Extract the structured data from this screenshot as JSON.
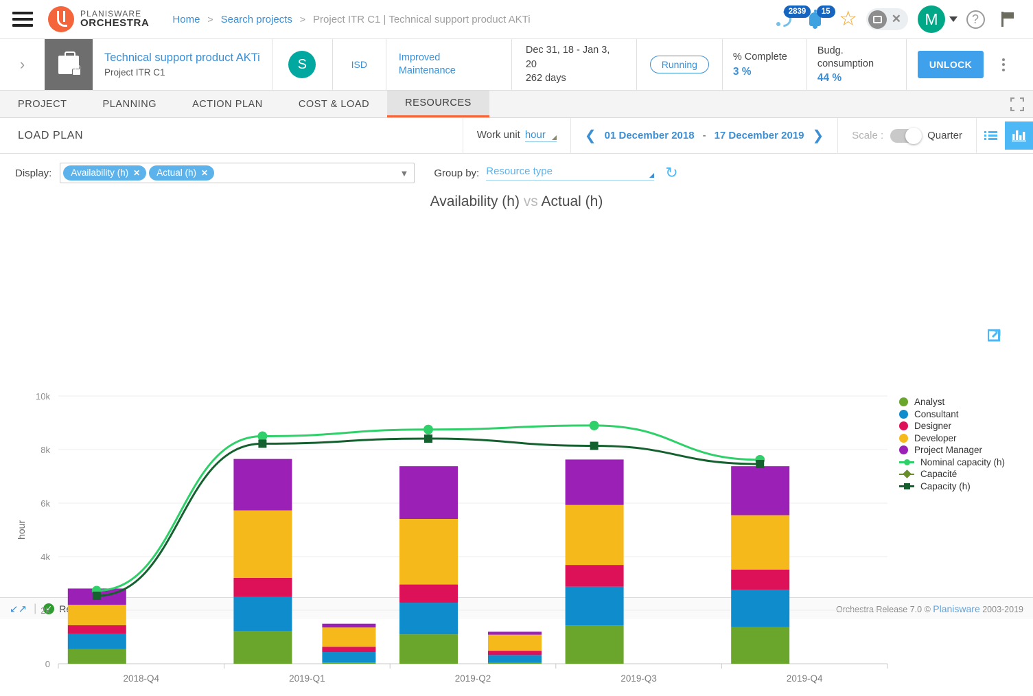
{
  "topbar": {
    "menu_icon": "hamburger-icon",
    "logo_line1": "PLANISWARE",
    "logo_line2": "ORCHESTRA",
    "breadcrumb": {
      "home": "Home",
      "search": "Search projects",
      "current": "Project ITR C1 | Technical support product AKTi",
      "separator": ">"
    },
    "feed_badge": "2839",
    "notification_badge": "15",
    "avatar_initial": "M"
  },
  "project": {
    "title": "Technical support product AKTi",
    "subtitle": "Project ITR C1",
    "stage_initial": "S",
    "org": "ISD",
    "category": "Improved Maintenance",
    "dates": "Dec 31, 18 - Jan 3, 20",
    "duration": "262 days",
    "status": "Running",
    "kpi1_label": "% Complete",
    "kpi1_value": "3 %",
    "kpi2_label": "Budg. consumption",
    "kpi2_value": "44 %",
    "unlock_label": "UNLOCK"
  },
  "tabs": [
    {
      "label": "PROJECT",
      "active": false
    },
    {
      "label": "PLANNING",
      "active": false
    },
    {
      "label": "ACTION PLAN",
      "active": false
    },
    {
      "label": "COST & LOAD",
      "active": false
    },
    {
      "label": "RESOURCES",
      "active": true
    }
  ],
  "toolbar": {
    "view_title": "LOAD PLAN",
    "work_unit_label": "Work unit",
    "work_unit_value": "hour",
    "date_from": "01 December 2018",
    "date_dash": "-",
    "date_to": "17 December 2019",
    "scale_label": "Scale :",
    "scale_value": "Quarter"
  },
  "controls": {
    "display_label": "Display:",
    "display_chips": [
      "Availability (h)",
      "Actual (h)"
    ],
    "group_by_label": "Group by:",
    "group_by_value": "Resource type"
  },
  "colors": {
    "accent_blue": "#3b8fd4",
    "bright_blue": "#4cb8f5",
    "orange": "#f4653b",
    "teal": "#00a887",
    "badge_blue": "#1565c0"
  },
  "chart_data": {
    "type": "bar",
    "title": "Availability (h) vs Actual (h)",
    "title_part1": "Availability (h)",
    "title_vs": "vs",
    "title_part2": "Actual (h)",
    "xlabel": "",
    "ylabel": "hour",
    "ylim": [
      0,
      10000
    ],
    "yticks": [
      0,
      2000,
      4000,
      6000,
      8000,
      10000
    ],
    "ytick_labels": [
      "0",
      "2k",
      "4k",
      "6k",
      "8k",
      "10k"
    ],
    "grid": true,
    "legend_position": "right",
    "categories": [
      "2018-Q4",
      "2019-Q1",
      "2019-Q2",
      "2019-Q3",
      "2019-Q4"
    ],
    "stacked_groups": [
      {
        "name": "Availability (h)",
        "offset": -1
      },
      {
        "name": "Actual (h)",
        "offset": 1
      }
    ],
    "series": [
      {
        "name": "Analyst",
        "color": "#6aa52c",
        "availability": [
          550,
          1230,
          1100,
          1430,
          1370
        ],
        "actual": [
          0,
          45,
          35,
          0,
          0
        ]
      },
      {
        "name": "Consultant",
        "color": "#0e8ccc",
        "availability": [
          560,
          1260,
          1180,
          1450,
          1400
        ],
        "actual": [
          0,
          390,
          290,
          0,
          0
        ]
      },
      {
        "name": "Designer",
        "color": "#dd1158",
        "availability": [
          330,
          720,
          680,
          810,
          750
        ],
        "actual": [
          0,
          200,
          160,
          0,
          0
        ]
      },
      {
        "name": "Developer",
        "color": "#f5b91c",
        "availability": [
          760,
          2520,
          2450,
          2240,
          2030
        ],
        "actual": [
          0,
          720,
          600,
          0,
          0
        ]
      },
      {
        "name": "Project Manager",
        "color": "#9b20b5",
        "availability": [
          610,
          1920,
          1970,
          1700,
          1830
        ],
        "actual": [
          0,
          140,
          110,
          0,
          0
        ]
      }
    ],
    "lines": [
      {
        "name": "Nominal capacity (h)",
        "color": "#2fd06a",
        "marker": "circle",
        "values": [
          2730,
          8500,
          8750,
          8900,
          7620
        ]
      },
      {
        "name": "Capacité",
        "color": "#6a8f2a",
        "marker": "diamond",
        "values": [
          null,
          null,
          null,
          null,
          null
        ]
      },
      {
        "name": "Capacity (h)",
        "color": "#14612f",
        "marker": "square",
        "values": [
          2540,
          8220,
          8410,
          8140,
          7460
        ]
      }
    ],
    "legend_entries": [
      {
        "label": "Analyst",
        "color": "#6aa52c",
        "kind": "dot"
      },
      {
        "label": "Consultant",
        "color": "#0e8ccc",
        "kind": "dot"
      },
      {
        "label": "Designer",
        "color": "#dd1158",
        "kind": "dot"
      },
      {
        "label": "Developer",
        "color": "#f5b91c",
        "kind": "dot"
      },
      {
        "label": "Project Manager",
        "color": "#9b20b5",
        "kind": "dot"
      },
      {
        "label": "Nominal capacity (h)",
        "color": "#2fd06a",
        "kind": "line-circle"
      },
      {
        "label": "Capacité",
        "color": "#6a8f2a",
        "kind": "line-diamond"
      },
      {
        "label": "Capacity (h)",
        "color": "#14612f",
        "kind": "line-square"
      }
    ]
  },
  "statusbar": {
    "ready": "Ready",
    "copyright_pre": "Orchestra Release 7.0 © ",
    "copyright_brand": "Planisware",
    "copyright_post": " 2003-2019"
  }
}
